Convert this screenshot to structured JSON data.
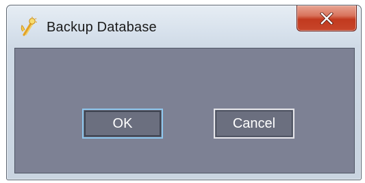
{
  "window": {
    "title": "Backup Database",
    "app_icon": "database-wand-icon",
    "close_icon": "close-icon"
  },
  "buttons": {
    "ok_label": "OK",
    "cancel_label": "Cancel"
  },
  "colors": {
    "client_background": "#7d8194",
    "button_background": "#6b6f7f",
    "focus_border": "#8ec7ee",
    "close_button": "#c7452a"
  }
}
